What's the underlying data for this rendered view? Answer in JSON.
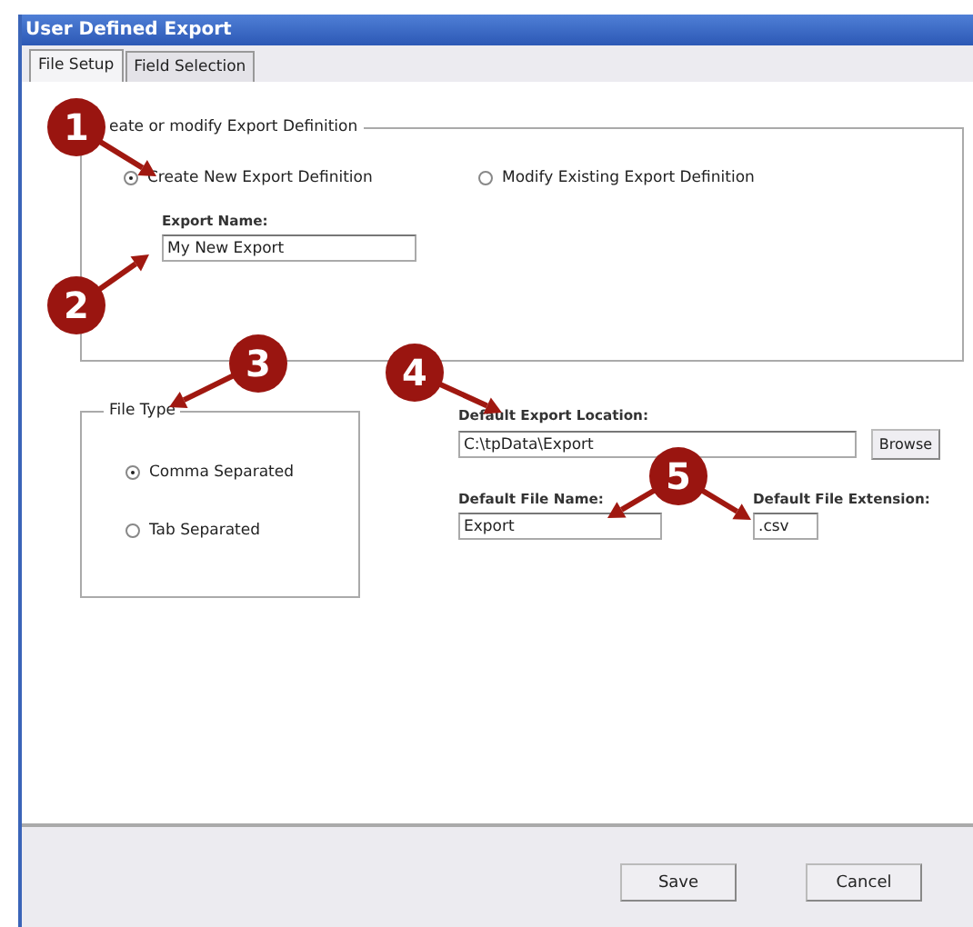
{
  "window": {
    "title": "User Defined Export"
  },
  "tabs": [
    {
      "label": "File Setup",
      "selected": true
    },
    {
      "label": "Field Selection",
      "selected": false
    }
  ],
  "definition_group": {
    "legend": "eate or modify Export Definition",
    "options": [
      {
        "label": "Create New Export Definition",
        "selected": true
      },
      {
        "label": "Modify Existing Export Definition",
        "selected": false
      }
    ],
    "export_name": {
      "label": "Export Name:",
      "value": "My New Export"
    }
  },
  "file_type_group": {
    "legend": "File Type",
    "options": [
      {
        "label": "Comma Separated",
        "selected": true
      },
      {
        "label": "Tab Separated",
        "selected": false
      }
    ]
  },
  "location": {
    "label": "Default Export Location:",
    "value": "C:\\tpData\\Export",
    "button": "Browse"
  },
  "file_name": {
    "label": "Default File Name:",
    "value": "Export"
  },
  "file_extension": {
    "label": "Default File Extension:",
    "value": ".csv"
  },
  "buttons": [
    "Save",
    "Cancel"
  ],
  "callouts": [
    {
      "number": "1"
    },
    {
      "number": "2"
    },
    {
      "number": "3"
    },
    {
      "number": "4"
    },
    {
      "number": "5"
    }
  ]
}
